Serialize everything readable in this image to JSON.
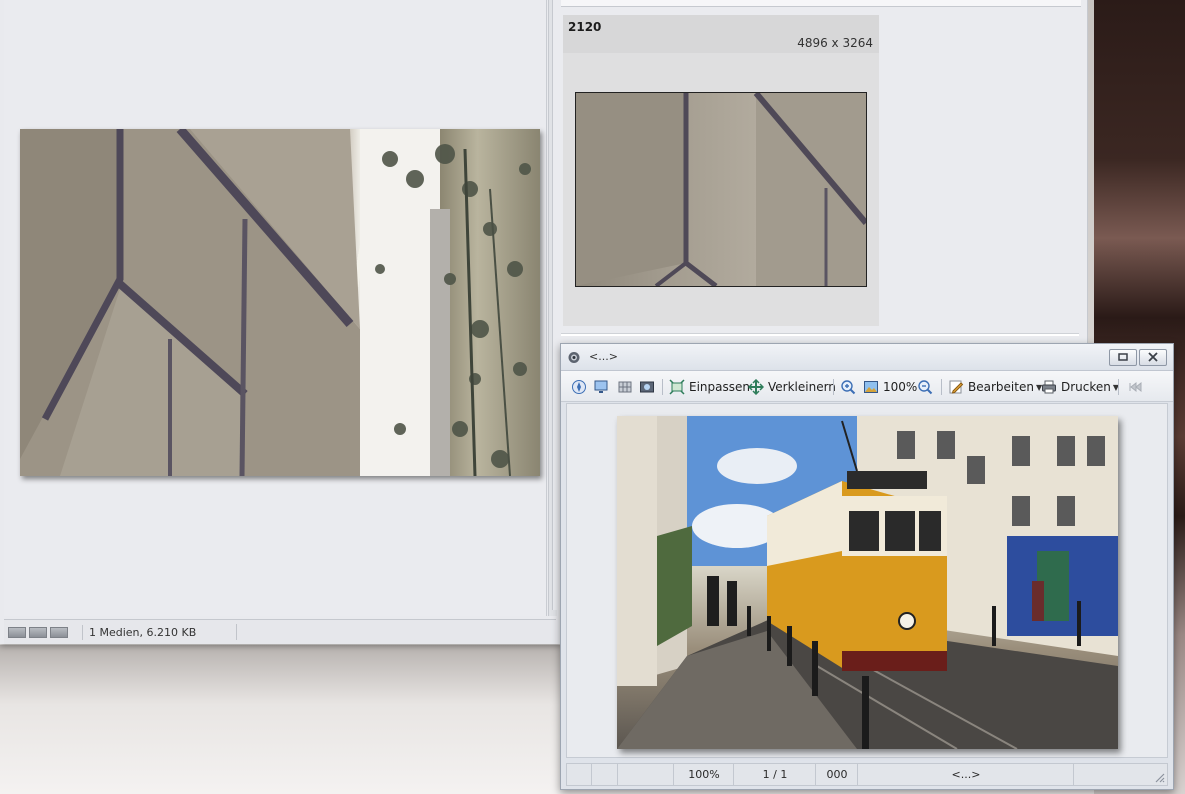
{
  "main_window": {
    "status_text": "1 Medien, 6.210 KB",
    "status_buttons": [
      "view-mode-icon",
      "view-mode-icon",
      "view-mode-icon"
    ]
  },
  "thumbnail": {
    "name": "2120",
    "dimensions": "4896 x 3264"
  },
  "viewer": {
    "title": "<...>",
    "toolbar": {
      "fit_label": "Einpassen",
      "shrink_label": "Verkleinern",
      "zoom_value": "100%",
      "edit_label": "Bearbeiten",
      "print_label": "Drucken"
    },
    "status": {
      "zoom": "100%",
      "page": "1 / 1",
      "code": "000",
      "name": "<...>"
    }
  },
  "colors": {
    "window_bg": "#e9eaee",
    "thumb_card_bg": "#dfdfe0",
    "tram_yellow": "#d99a1e",
    "tile_blue": "#2d4d9e"
  }
}
